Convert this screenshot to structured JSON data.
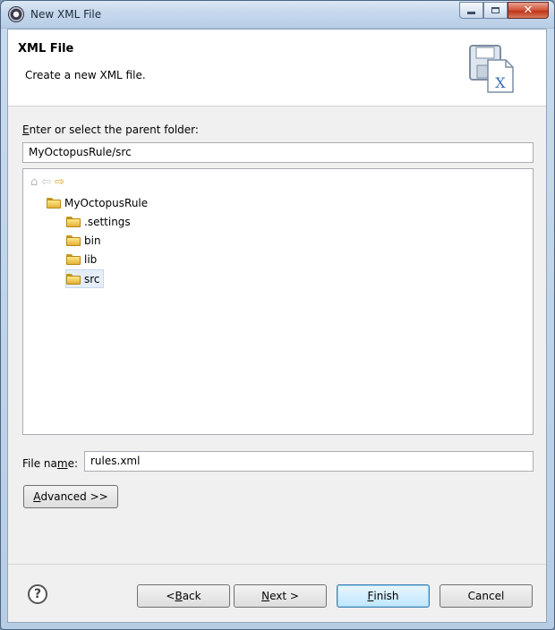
{
  "window": {
    "title": "New XML File"
  },
  "header": {
    "title": "XML File",
    "description": "Create a new XML file."
  },
  "parent_folder": {
    "label_prefix": "E",
    "label_rest": "nter or select the parent folder:",
    "value": "MyOctopusRule/src"
  },
  "tree": {
    "nav": [
      "home-icon",
      "back-arrow-icon",
      "forward-arrow-icon"
    ],
    "project": "MyOctopusRule",
    "folders": [
      ".settings",
      "bin",
      "lib",
      "src"
    ],
    "selected": "src"
  },
  "file_name": {
    "label_before": "File na",
    "label_underline": "m",
    "label_after": "e:",
    "value": "rules.xml"
  },
  "advanced": {
    "u": "A",
    "rest": "dvanced >>"
  },
  "buttons": {
    "back_pre": "< ",
    "back_u": "B",
    "back_rest": "ack",
    "next_u": "N",
    "next_rest": "ext >",
    "finish_u": "F",
    "finish_rest": "inish",
    "cancel": "Cancel"
  },
  "colors": {
    "selection": "#e5eef8",
    "default_button": "#3c7fb1",
    "close_button": "#c7432a"
  }
}
